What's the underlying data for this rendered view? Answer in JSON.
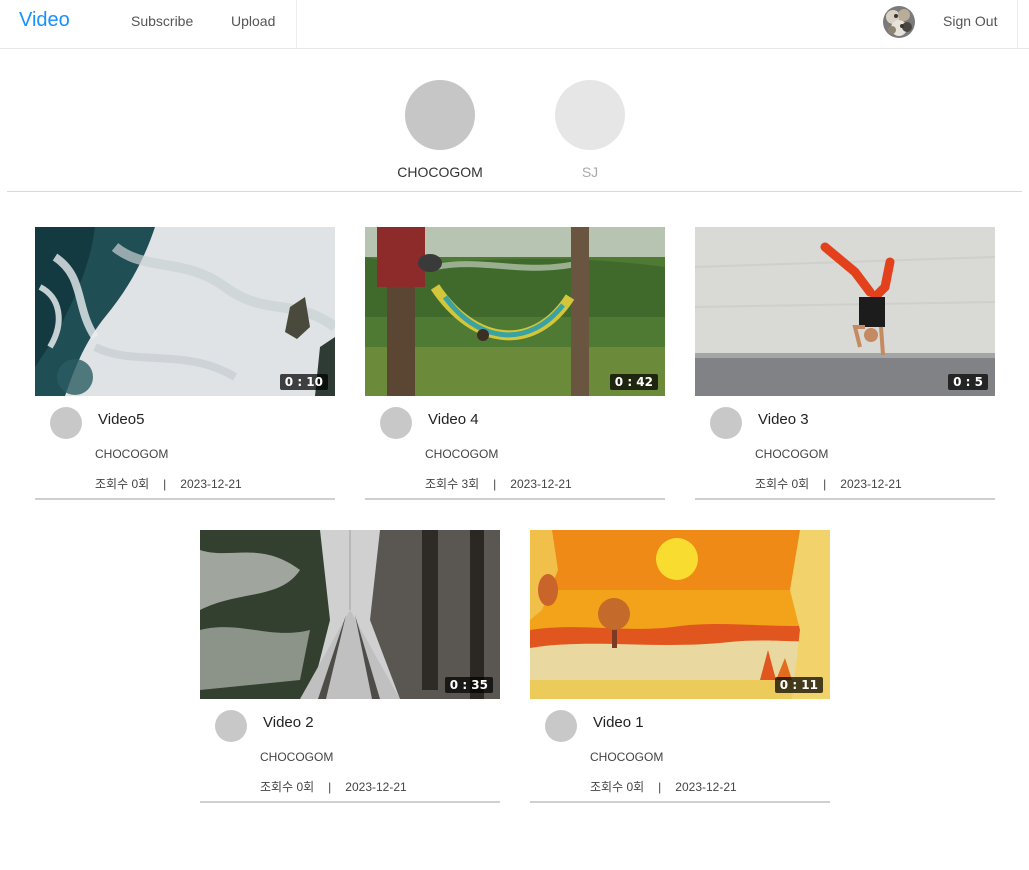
{
  "header": {
    "logo": "Video",
    "nav": [
      "Subscribe",
      "Upload"
    ],
    "sign_out": "Sign Out"
  },
  "channels": [
    {
      "name": "CHOCOGOM",
      "active": true,
      "color": "#c6c6c6"
    },
    {
      "name": "SJ",
      "active": false,
      "color": "#e6e6e6"
    }
  ],
  "videos": [
    {
      "title": "Video5",
      "channel": "CHOCOGOM",
      "views": "조회수 0회",
      "date": "2023-12-21",
      "duration": "0 : 10",
      "thumb": "waves-thumbnail"
    },
    {
      "title": "Video 4",
      "channel": "CHOCOGOM",
      "views": "조회수 3회",
      "date": "2023-12-21",
      "duration": "0 : 42",
      "thumb": "hammock-thumbnail"
    },
    {
      "title": "Video 3",
      "channel": "CHOCOGOM",
      "views": "조회수 0회",
      "date": "2023-12-21",
      "duration": "0 : 5",
      "thumb": "handstand-thumbnail"
    },
    {
      "title": "Video 2",
      "channel": "CHOCOGOM",
      "views": "조회수 0회",
      "date": "2023-12-21",
      "duration": "0 : 35",
      "thumb": "snowy-road-thumbnail"
    },
    {
      "title": "Video 1",
      "channel": "CHOCOGOM",
      "views": "조회수 0회",
      "date": "2023-12-21",
      "duration": "0 : 11",
      "thumb": "autumn-sun-thumbnail"
    }
  ],
  "colors": {
    "accent": "#1890ff",
    "active_channel": "#333333",
    "inactive_channel": "#aaaaaa"
  },
  "separator": "|"
}
